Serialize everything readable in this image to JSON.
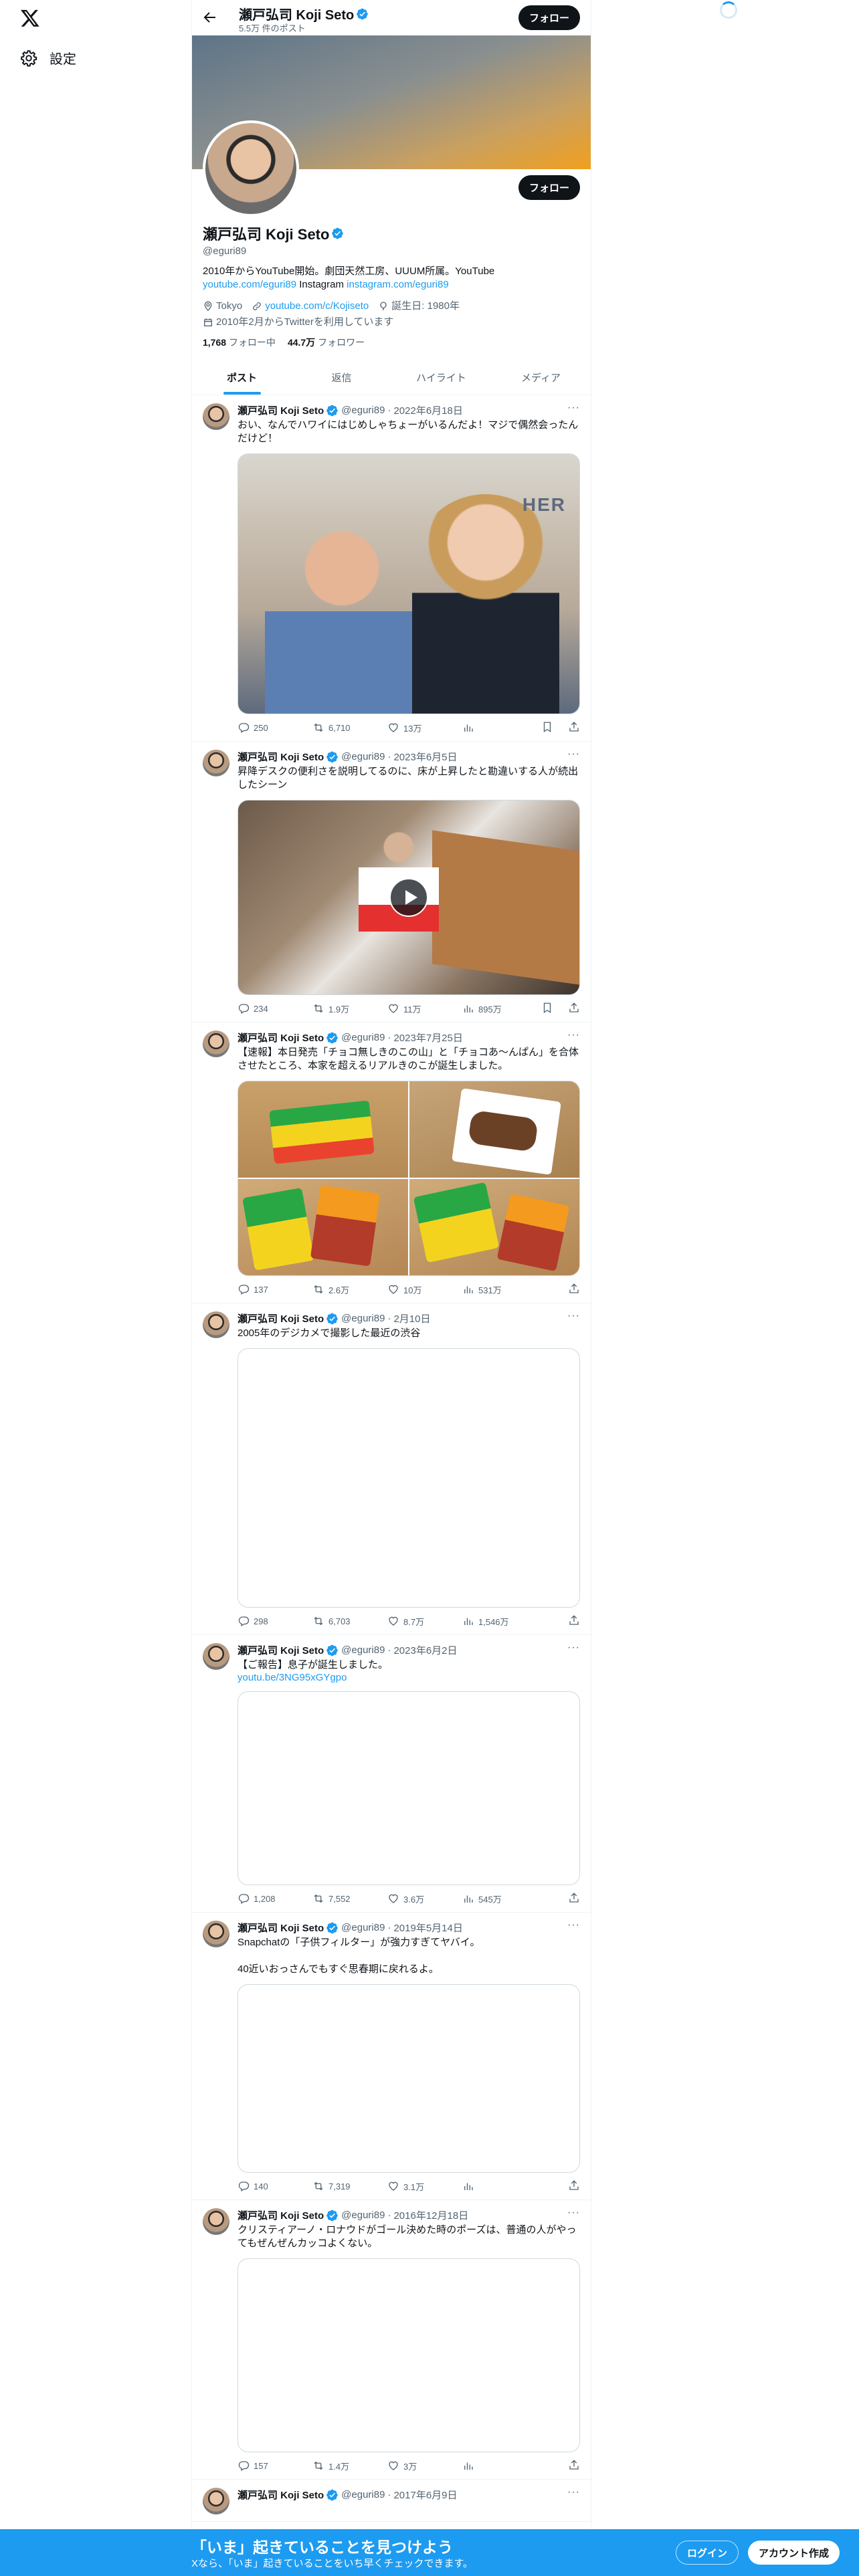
{
  "nav": {
    "settings_label": "設定"
  },
  "header": {
    "name": "瀬戸弘司 Koji Seto",
    "post_count": "5.5万 件のポスト",
    "follow_label": "フォロー"
  },
  "profile": {
    "name": "瀬戸弘司 Koji Seto",
    "handle": "@eguri89",
    "follow_label": "フォロー",
    "bio_line1": "2010年からYouTube開始。劇団天然工房、UUUM所属。YouTube",
    "bio_link1": "youtube.com/eguri89",
    "bio_mid": " Instagram ",
    "bio_link2": "instagram.com/eguri89",
    "location": "Tokyo",
    "website": "youtube.com/c/Kojiseto",
    "birthday": "誕生日: 1980年",
    "joined": "2010年2月からTwitterを利用しています",
    "following_count": "1,768",
    "following_label": "フォロー中",
    "followers_count": "44.7万",
    "followers_label": "フォロワー"
  },
  "tabs": [
    "ポスト",
    "返信",
    "ハイライト",
    "メディア"
  ],
  "tweets": [
    {
      "name": "瀬戸弘司 Koji Seto",
      "handle": "@eguri89",
      "date": "2022年6月18日",
      "text": "おい、なんでハワイにはじめしゃちょーがいるんだよ！マジで偶然会ったんだけど！",
      "link": "",
      "replies": "250",
      "retweets": "6,710",
      "likes": "13万",
      "views": ""
    },
    {
      "name": "瀬戸弘司 Koji Seto",
      "handle": "@eguri89",
      "date": "2023年6月5日",
      "text": "昇降デスクの便利さを説明してるのに、床が上昇したと勘違いする人が続出したシーン",
      "link": "",
      "replies": "234",
      "retweets": "1.9万",
      "likes": "11万",
      "views": "895万"
    },
    {
      "name": "瀬戸弘司 Koji Seto",
      "handle": "@eguri89",
      "date": "2023年7月25日",
      "text": "【速報】本日発売「チョコ無しきのこの山」と「チョコあ〜んぱん」を合体させたところ、本家を超えるリアルきのこが誕生しました。",
      "link": "",
      "replies": "137",
      "retweets": "2.6万",
      "likes": "10万",
      "views": "531万"
    },
    {
      "name": "瀬戸弘司 Koji Seto",
      "handle": "@eguri89",
      "date": "2月10日",
      "text": "2005年のデジカメで撮影した最近の渋谷",
      "link": "",
      "replies": "298",
      "retweets": "6,703",
      "likes": "8.7万",
      "views": "1,546万"
    },
    {
      "name": "瀬戸弘司 Koji Seto",
      "handle": "@eguri89",
      "date": "2023年6月2日",
      "text": "【ご報告】息子が誕生しました。",
      "link": "youtu.be/3NG95xGYgpo",
      "replies": "1,208",
      "retweets": "7,552",
      "likes": "3.6万",
      "views": "545万"
    },
    {
      "name": "瀬戸弘司 Koji Seto",
      "handle": "@eguri89",
      "date": "2019年5月14日",
      "text": "Snapchatの「子供フィルター」が強力すぎてヤバイ。\n\n40近いおっさんでもすぐ思春期に戻れるよ。",
      "link": "",
      "replies": "140",
      "retweets": "7,319",
      "likes": "3.1万",
      "views": ""
    },
    {
      "name": "瀬戸弘司 Koji Seto",
      "handle": "@eguri89",
      "date": "2016年12月18日",
      "text": "クリスティアーノ・ロナウドがゴール決めた時のポーズは、普通の人がやってもぜんぜんカッコよくない。",
      "link": "",
      "replies": "157",
      "retweets": "1.4万",
      "likes": "3万",
      "views": ""
    },
    {
      "name": "瀬戸弘司 Koji Seto",
      "handle": "@eguri89",
      "date": "2017年6月9日",
      "text": "",
      "link": "",
      "replies": "",
      "retweets": "",
      "likes": "",
      "views": ""
    }
  ],
  "bottom_bar": {
    "title": "「いま」起きていることを見つけよう",
    "subtitle": "Xなら、「いま」起きていることをいち早くチェックできます。",
    "login_label": "ログイン",
    "signup_label": "アカウント作成"
  },
  "colors": {
    "accent": "#1d9bf0",
    "text": "#0f1419",
    "muted": "#536471"
  }
}
